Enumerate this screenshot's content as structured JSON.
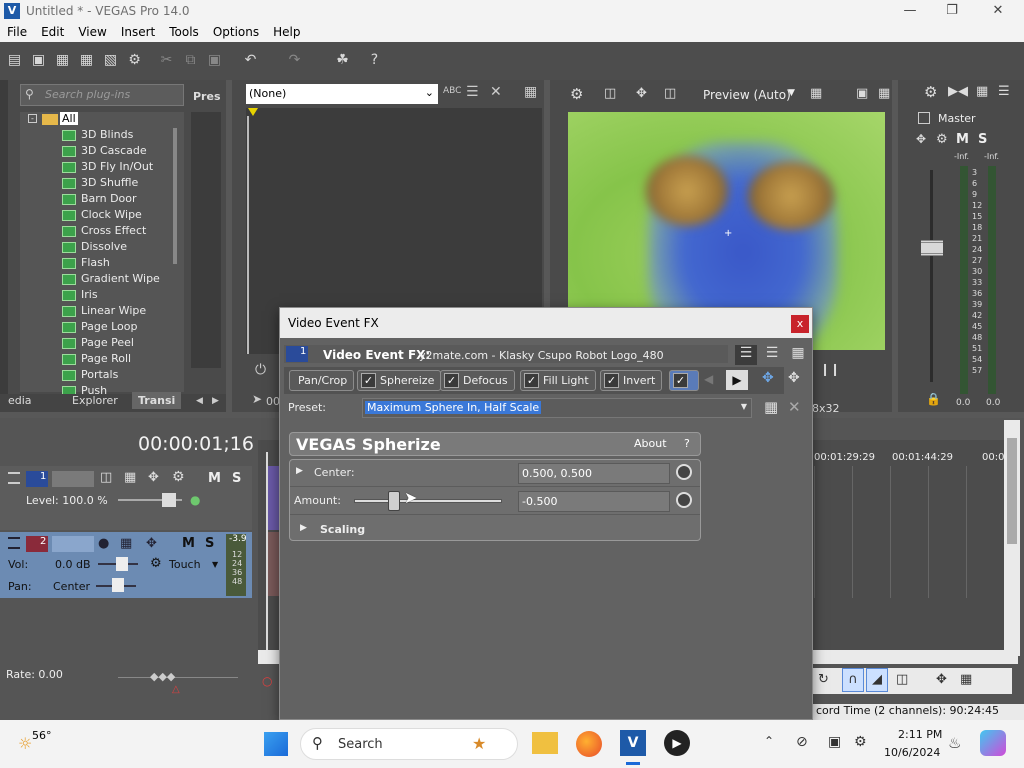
{
  "window": {
    "title": "Untitled * - VEGAS Pro 14.0",
    "icon": "vegas-logo-icon"
  },
  "menu": [
    "File",
    "Edit",
    "View",
    "Insert",
    "Tools",
    "Options",
    "Help"
  ],
  "explorer": {
    "search_placeholder": "Search plug-ins",
    "presets_header": "Pres",
    "root": "All",
    "items": [
      "3D Blinds",
      "3D Cascade",
      "3D Fly In/Out",
      "3D Shuffle",
      "Barn Door",
      "Clock Wipe",
      "Cross Effect",
      "Dissolve",
      "Flash",
      "Gradient Wipe",
      "Iris",
      "Linear Wipe",
      "Page Loop",
      "Page Peel",
      "Page Roll",
      "Portals",
      "Push"
    ],
    "tabs": [
      "edia",
      "Explorer",
      "Transi"
    ]
  },
  "trimmer": {
    "dropdown": "(None)",
    "time_prefix": "00"
  },
  "preview": {
    "mode": "Preview (Auto)",
    "resolution": "8x32"
  },
  "mixer": {
    "title": "Master",
    "labels": [
      "-Inf.",
      "-Inf."
    ],
    "scale": [
      "3",
      "6",
      "9",
      "12",
      "15",
      "18",
      "21",
      "24",
      "27",
      "30",
      "33",
      "36",
      "39",
      "42",
      "45",
      "48",
      "51",
      "54",
      "57"
    ],
    "readouts": [
      "0.0",
      "0.0"
    ]
  },
  "timeline": {
    "timecode": "00:00:01;16",
    "ruler": [
      "00:01:29:29",
      "00:01:44:29",
      "00:0"
    ],
    "track1": {
      "number": "1",
      "level_label": "Level: 100.0 %"
    },
    "track2": {
      "number": "2",
      "vol": "Vol:",
      "vol_value": "0.0 dB",
      "pan": "Pan:",
      "pan_value": "Center",
      "automation": "Touch",
      "peak": "-3.9",
      "meter_nums": [
        "12",
        "24",
        "36",
        "48"
      ]
    },
    "rate": "Rate: 0.00",
    "record_time": "cord Time (2 channels): 90:24:45"
  },
  "dialog": {
    "title": "Video Event FX",
    "close": "x",
    "header_label": "Video Event FX:",
    "header_value": "y2mate.com - Klasky Csupo Robot Logo_480",
    "chain_number": "1",
    "chain": [
      "Pan/Crop",
      "Sphereize",
      "Defocus",
      "Fill Light",
      "Invert"
    ],
    "preset_label": "Preset:",
    "preset_value": "Maximum Sphere In, Half Scale",
    "plugin_name": "VEGAS Spherize",
    "about": "About",
    "help": "?",
    "center_label": "Center:",
    "center_value": "0.500, 0.500",
    "amount_label": "Amount:",
    "amount_value": "-0.500",
    "amount_slider": 0.25,
    "scaling_label": "Scaling"
  },
  "taskbar": {
    "temp": "56°",
    "search": "Search",
    "time": "2:11 PM",
    "date": "10/6/2024"
  }
}
